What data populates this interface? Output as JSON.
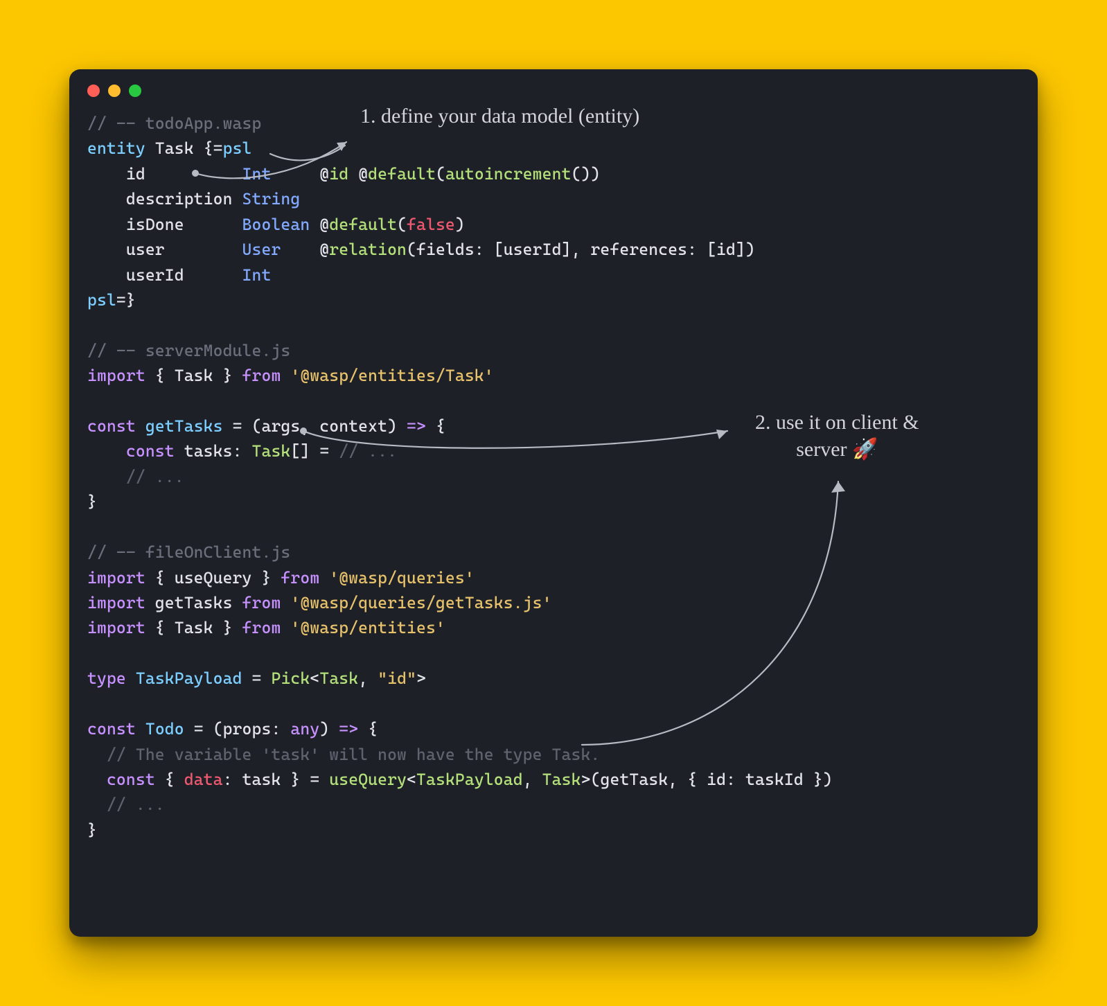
{
  "annotations": {
    "a1": "1. define your data model (entity)",
    "a2_line1": "2. use it on client &",
    "a2_line2": "server 🚀"
  },
  "code": {
    "l01_a": "// -- todoApp.wasp",
    "l02_a": "entity",
    "l02_b": " Task ",
    "l02_c": "{=",
    "l02_d": "psl",
    "l03_a": "    id          ",
    "l03_b": "Int",
    "l03_c": "     @",
    "l03_d": "id",
    "l03_e": " @",
    "l03_f": "default",
    "l03_g": "(",
    "l03_h": "autoincrement",
    "l03_i": "())",
    "l04_a": "    description ",
    "l04_b": "String",
    "l05_a": "    isDone      ",
    "l05_b": "Boolean",
    "l05_c": " @",
    "l05_d": "default",
    "l05_e": "(",
    "l05_f": "false",
    "l05_g": ")",
    "l06_a": "    user        ",
    "l06_b": "User",
    "l06_c": "    @",
    "l06_d": "relation",
    "l06_e": "(fields: [userId], references: [id])",
    "l07_a": "    userId      ",
    "l07_b": "Int",
    "l08_a": "psl",
    "l08_b": "=}",
    "l10_a": "// -- serverModule.js",
    "l11_a": "import",
    "l11_b": " { Task } ",
    "l11_c": "from",
    "l11_d": " '@wasp/entities/Task'",
    "l13_a": "const",
    "l13_b": " ",
    "l13_c": "getTasks",
    "l13_d": " = (args, context) ",
    "l13_e": "=>",
    "l13_f": " {",
    "l14_a": "    ",
    "l14_b": "const",
    "l14_c": " tasks: ",
    "l14_d": "Task",
    "l14_e": "[] = ",
    "l14_f": "// ...",
    "l15_a": "    ",
    "l15_b": "// ...",
    "l16_a": "}",
    "l18_a": "// -- fileOnClient.js",
    "l19_a": "import",
    "l19_b": " { useQuery } ",
    "l19_c": "from",
    "l19_d": " '@wasp/queries'",
    "l20_a": "import",
    "l20_b": " getTasks ",
    "l20_c": "from",
    "l20_d": " '@wasp/queries/getTasks.js'",
    "l21_a": "import",
    "l21_b": " { Task } ",
    "l21_c": "from",
    "l21_d": " '@wasp/entities'",
    "l23_a": "type",
    "l23_b": " ",
    "l23_c": "TaskPayload",
    "l23_d": " = ",
    "l23_e": "Pick",
    "l23_f": "<",
    "l23_g": "Task",
    "l23_h": ", ",
    "l23_i": "\"id\"",
    "l23_j": ">",
    "l25_a": "const",
    "l25_b": " ",
    "l25_c": "Todo",
    "l25_d": " = (props: ",
    "l25_e": "any",
    "l25_f": ") ",
    "l25_g": "=>",
    "l25_h": " {",
    "l26_a": "  ",
    "l26_b": "// The variable 'task' will now have the type Task.",
    "l27_a": "  ",
    "l27_b": "const",
    "l27_c": " { ",
    "l27_d": "data",
    "l27_e": ": task } = ",
    "l27_f": "useQuery",
    "l27_g": "<",
    "l27_h": "TaskPayload",
    "l27_i": ", ",
    "l27_j": "Task",
    "l27_k": ">(getTask, { id: taskId })",
    "l28_a": "  ",
    "l28_b": "// ...",
    "l29_a": "}"
  }
}
